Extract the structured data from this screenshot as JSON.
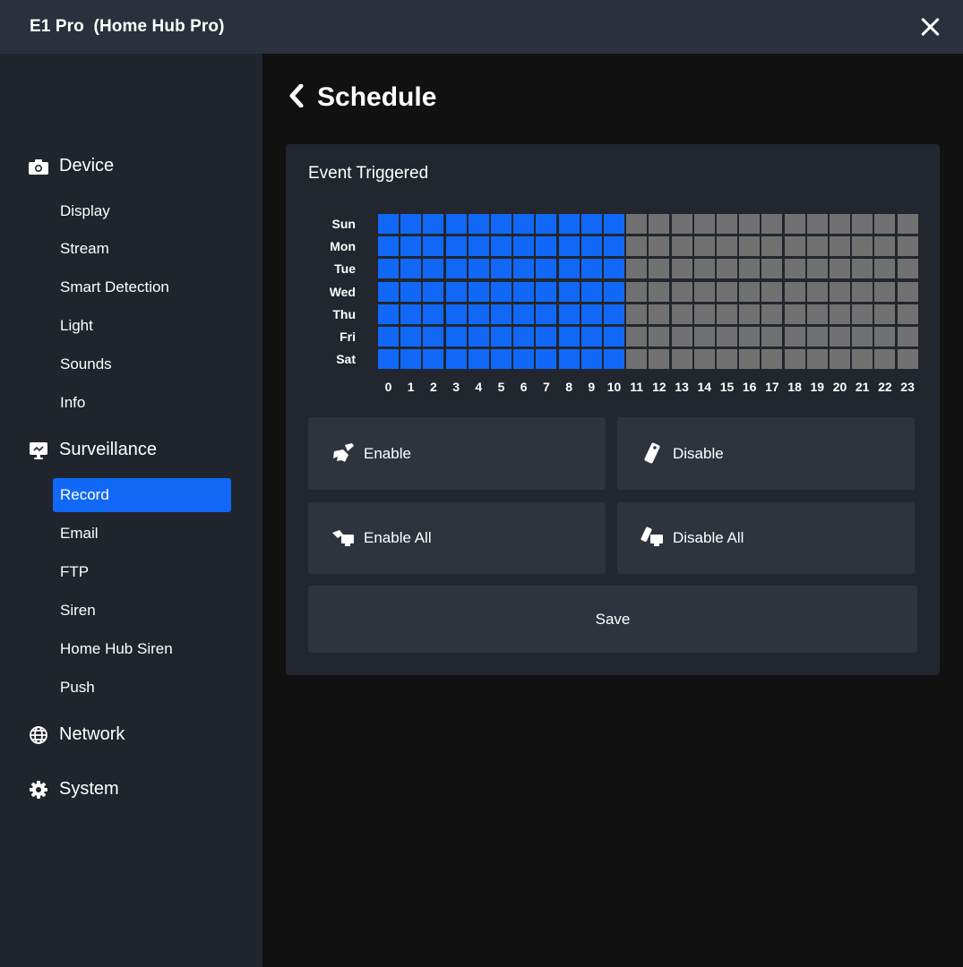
{
  "window": {
    "title": "E1 Pro  (Home Hub Pro)",
    "close_icon": "close-icon"
  },
  "sidebar": {
    "groups": [
      {
        "label": "Device",
        "icon": "camera-icon",
        "items": [
          "Display",
          "Stream",
          "Smart Detection",
          "Light",
          "Sounds",
          "Info"
        ]
      },
      {
        "label": "Surveillance",
        "icon": "monitor-icon",
        "items": [
          "Record",
          "Email",
          "FTP",
          "Siren",
          "Home Hub Siren",
          "Push"
        ]
      },
      {
        "label": "Network",
        "icon": "globe-icon",
        "items": []
      },
      {
        "label": "System",
        "icon": "gear-icon",
        "items": []
      }
    ],
    "active_item": "Record"
  },
  "main": {
    "back_icon": "chevron-left-icon",
    "title": "Schedule",
    "panel_title": "Event Triggered",
    "days": [
      "Sun",
      "Mon",
      "Tue",
      "Wed",
      "Thu",
      "Fri",
      "Sat"
    ],
    "hours": [
      "0",
      "1",
      "2",
      "3",
      "4",
      "5",
      "6",
      "7",
      "8",
      "9",
      "10",
      "11",
      "12",
      "13",
      "14",
      "15",
      "16",
      "17",
      "18",
      "19",
      "20",
      "21",
      "22",
      "23"
    ],
    "schedule": [
      [
        1,
        1,
        1,
        1,
        1,
        1,
        1,
        1,
        1,
        1,
        1,
        0,
        0,
        0,
        0,
        0,
        0,
        0,
        0,
        0,
        0,
        0,
        0,
        0
      ],
      [
        1,
        1,
        1,
        1,
        1,
        1,
        1,
        1,
        1,
        1,
        1,
        0,
        0,
        0,
        0,
        0,
        0,
        0,
        0,
        0,
        0,
        0,
        0,
        0
      ],
      [
        1,
        1,
        1,
        1,
        1,
        1,
        1,
        1,
        1,
        1,
        1,
        0,
        0,
        0,
        0,
        0,
        0,
        0,
        0,
        0,
        0,
        0,
        0,
        0
      ],
      [
        1,
        1,
        1,
        1,
        1,
        1,
        1,
        1,
        1,
        1,
        1,
        0,
        0,
        0,
        0,
        0,
        0,
        0,
        0,
        0,
        0,
        0,
        0,
        0
      ],
      [
        1,
        1,
        1,
        1,
        1,
        1,
        1,
        1,
        1,
        1,
        1,
        0,
        0,
        0,
        0,
        0,
        0,
        0,
        0,
        0,
        0,
        0,
        0,
        0
      ],
      [
        1,
        1,
        1,
        1,
        1,
        1,
        1,
        1,
        1,
        1,
        1,
        0,
        0,
        0,
        0,
        0,
        0,
        0,
        0,
        0,
        0,
        0,
        0,
        0
      ],
      [
        1,
        1,
        1,
        1,
        1,
        1,
        1,
        1,
        1,
        1,
        1,
        0,
        0,
        0,
        0,
        0,
        0,
        0,
        0,
        0,
        0,
        0,
        0,
        0
      ]
    ],
    "buttons": {
      "enable": {
        "label": "Enable",
        "icon": "brush-icon"
      },
      "disable": {
        "label": "Disable",
        "icon": "eraser-icon"
      },
      "enable_all": {
        "label": "Enable All",
        "icon": "brush-all-icon"
      },
      "disable_all": {
        "label": "Disable All",
        "icon": "eraser-all-icon"
      },
      "save": {
        "label": "Save"
      }
    }
  },
  "colors": {
    "enabled": "#1168f7",
    "disabled": "#717171",
    "active_nav": "#1168f7",
    "titlebar": "#2b313c",
    "sidebar": "#20242c",
    "background": "#111111",
    "panel": "#22262e",
    "button": "#2e333e"
  }
}
